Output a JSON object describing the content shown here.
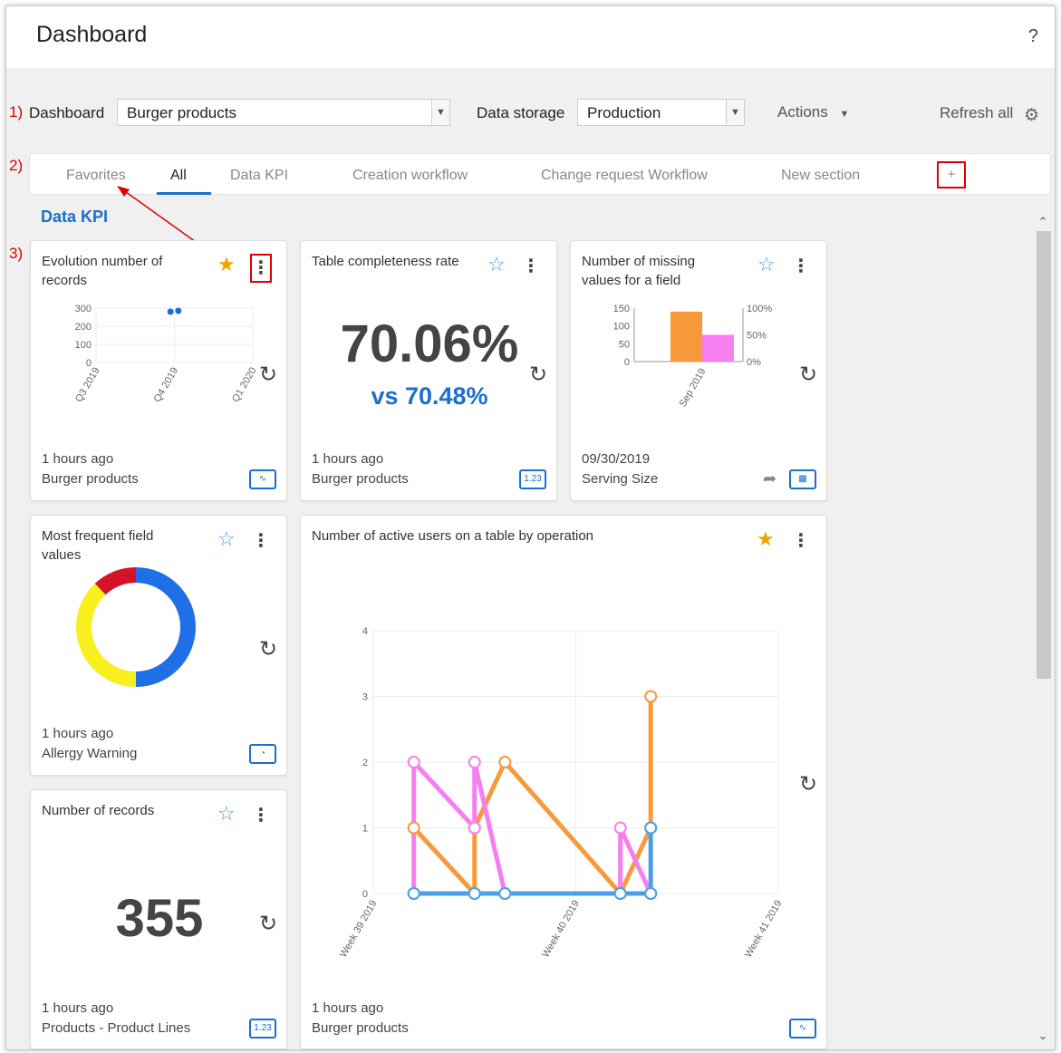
{
  "header": {
    "title": "Dashboard",
    "help": "?"
  },
  "controls": {
    "annotation_1": "1)",
    "dashboard_label": "Dashboard",
    "dashboard_value": "Burger products",
    "storage_label": "Data storage",
    "storage_value": "Production",
    "actions_label": "Actions",
    "refresh_all_label": "Refresh all"
  },
  "tabs": {
    "annotation_2": "2)",
    "items": [
      "Favorites",
      "All",
      "Data KPI",
      "Creation workflow",
      "Change request Workflow",
      "New section"
    ],
    "active": "All",
    "add_label": "+"
  },
  "section": {
    "title": "Data KPI",
    "annotation_3": "3)"
  },
  "cards": [
    {
      "title": "Evolution number of records",
      "starred": true,
      "footer_time": "1 hours ago",
      "footer_source": "Burger products",
      "type_icon": "line-chart-icon"
    },
    {
      "title": "Table completeness rate",
      "starred": false,
      "big_value": "70.06%",
      "compare_value": "vs 70.48%",
      "footer_time": "1 hours ago",
      "footer_source": "Burger products",
      "type_icon": "number-icon",
      "type_text": "1.23"
    },
    {
      "title": "Number of missing values for a field",
      "starred": false,
      "footer_time": "09/30/2019",
      "footer_source": "Serving Size",
      "type_icon": "bar-chart-icon"
    },
    {
      "title": "Most frequent field values",
      "starred": false,
      "footer_time": "1 hours ago",
      "footer_source": "Allergy Warning",
      "type_icon": "pie-chart-icon"
    },
    {
      "title": "Number of active users on a table by operation",
      "starred": true,
      "footer_time": "1 hours ago",
      "footer_source": "Burger products",
      "type_icon": "line-chart-icon"
    },
    {
      "title": "Number of records",
      "starred": false,
      "big_value": "355",
      "footer_time": "1 hours ago",
      "footer_source": "Products - Product Lines",
      "type_icon": "number-icon",
      "type_text": "1.23"
    }
  ],
  "chart_data": [
    {
      "type": "scatter",
      "categories": [
        "Q3 2019",
        "Q4 2019",
        "Q1 2020"
      ],
      "yticks": [
        "300",
        "200",
        "100",
        "0"
      ],
      "ylim": [
        0,
        300
      ],
      "series": [
        {
          "x": [
            0.95,
            1.05
          ],
          "values": [
            280,
            285
          ],
          "color": "#1a6fd0"
        }
      ]
    },
    {
      "type": "bar",
      "categories": [
        "Sep 2019"
      ],
      "yticks_left": [
        "150",
        "100",
        "50",
        "0"
      ],
      "yticks_right": [
        "100%",
        "50%",
        "0%"
      ],
      "ylim": [
        0,
        150
      ],
      "series": [
        {
          "values": [
            140
          ],
          "color": "#f89a3c"
        },
        {
          "values": [
            75
          ],
          "color": "#f77ef0"
        }
      ]
    },
    {
      "type": "pie",
      "donut": true,
      "slices": [
        {
          "value": 50,
          "color": "#1f6fe6"
        },
        {
          "value": 38,
          "color": "#f7f01e"
        },
        {
          "value": 12,
          "color": "#d4122a"
        }
      ]
    },
    {
      "type": "line",
      "xticks": [
        "Week 39 2019",
        "Week 40 2019",
        "Week 41 2019"
      ],
      "yticks": [
        "4",
        "3",
        "2",
        "1",
        "0"
      ],
      "ylim": [
        0,
        4
      ],
      "series": [
        {
          "color": "#f89a3c",
          "points": [
            [
              0.2,
              1
            ],
            [
              0.5,
              0
            ],
            [
              0.5,
              1
            ],
            [
              0.65,
              2
            ],
            [
              1.22,
              0
            ],
            [
              1.37,
              1
            ],
            [
              1.37,
              3
            ]
          ]
        },
        {
          "color": "#f77ef0",
          "points": [
            [
              0.2,
              0
            ],
            [
              0.2,
              2
            ],
            [
              0.5,
              1
            ],
            [
              0.5,
              2
            ],
            [
              0.65,
              0
            ],
            [
              1.22,
              0
            ],
            [
              1.22,
              1
            ],
            [
              1.37,
              0
            ]
          ]
        },
        {
          "color": "#4aa0e8",
          "points": [
            [
              0.2,
              0
            ],
            [
              0.5,
              0
            ],
            [
              0.65,
              0
            ],
            [
              1.22,
              0
            ],
            [
              1.37,
              0
            ],
            [
              1.37,
              1
            ]
          ]
        }
      ]
    }
  ]
}
